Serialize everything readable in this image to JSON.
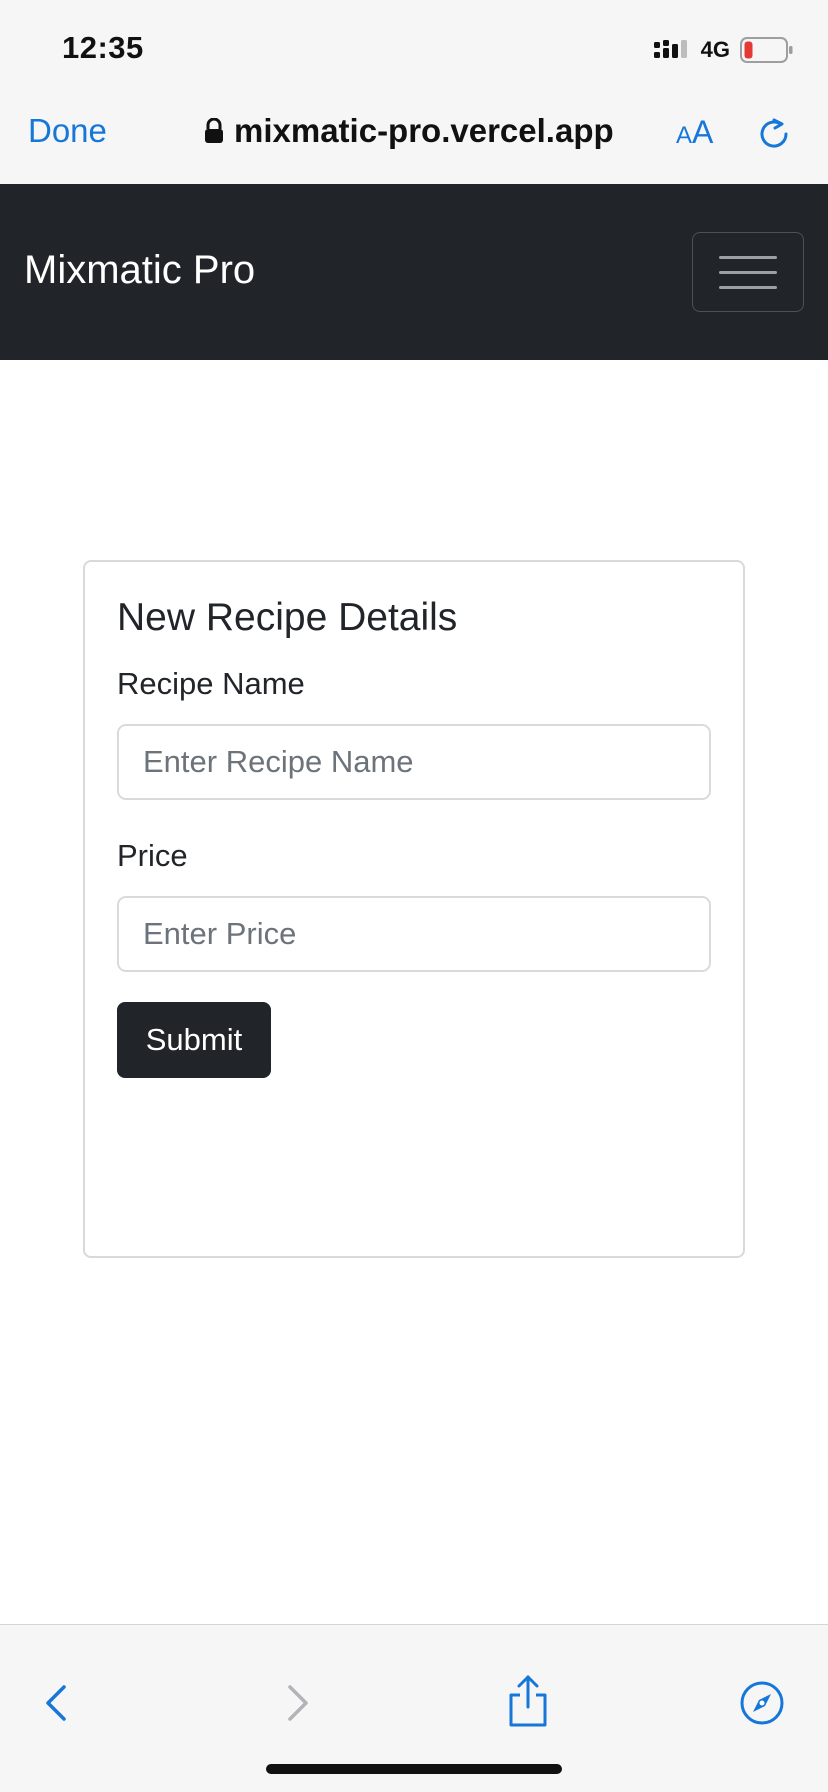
{
  "status_bar": {
    "time": "12:35",
    "network": "4G",
    "signal_icon": "signal-bars-icon",
    "battery_icon": "battery-low-icon",
    "battery_color": "#e53935"
  },
  "browser": {
    "done_label": "Done",
    "url": "mixmatic-pro.vercel.app",
    "text_size_small": "A",
    "text_size_big": "A",
    "accent_color": "#1677d9"
  },
  "navbar": {
    "brand": "Mixmatic Pro",
    "background": "#212529"
  },
  "form": {
    "title": "New Recipe Details",
    "recipe_name_label": "Recipe Name",
    "recipe_name_placeholder": "Enter Recipe Name",
    "recipe_name_value": "",
    "price_label": "Price",
    "price_placeholder": "Enter Price",
    "price_value": "",
    "submit_label": "Submit"
  },
  "toolbar": {
    "icons": [
      "chevron-left-icon",
      "chevron-right-icon",
      "share-icon",
      "compass-icon"
    ]
  }
}
